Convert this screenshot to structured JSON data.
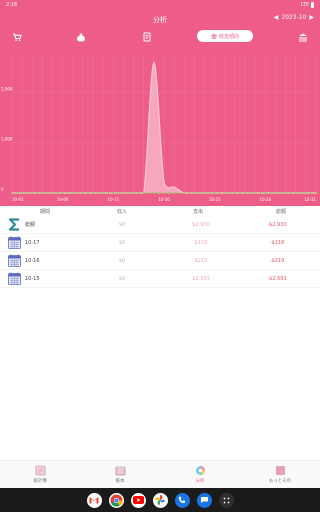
{
  "status_bar": {
    "time": "2:16",
    "network": "LTE"
  },
  "header": {
    "title": "分析",
    "month": "2023-10",
    "prev_icon": "chevron-left-icon",
    "next_icon": "chevron-right-icon",
    "mode_label": "收支傾向"
  },
  "toolbar": {
    "icons": [
      "cart-icon",
      "money-bag-icon",
      "receipt-icon",
      "bank-icon"
    ]
  },
  "chart_data": {
    "type": "area",
    "x_tick_labels": [
      "10-01",
      "10-06",
      "10-11",
      "10-16",
      "10-21",
      "10-26",
      "10-31"
    ],
    "y_tick_labels": [
      "2,000",
      "1,000",
      "0"
    ],
    "x": [
      "10-01",
      "10-02",
      "10-03",
      "10-04",
      "10-05",
      "10-06",
      "10-07",
      "10-08",
      "10-09",
      "10-10",
      "10-11",
      "10-12",
      "10-13",
      "10-14",
      "10-15",
      "10-16",
      "10-17",
      "10-18",
      "10-19",
      "10-20",
      "10-21",
      "10-22",
      "10-23",
      "10-24",
      "10-25",
      "10-26",
      "10-27",
      "10-28",
      "10-29",
      "10-30",
      "10-31"
    ],
    "series": [
      {
        "values": [
          0,
          0,
          0,
          0,
          0,
          0,
          0,
          0,
          0,
          0,
          0,
          0,
          0,
          0,
          2593,
          219,
          118,
          0,
          0,
          0,
          0,
          0,
          0,
          0,
          0,
          0,
          0,
          0,
          0,
          0,
          0
        ]
      }
    ],
    "ylim": [
      0,
      2800
    ],
    "colors": {
      "background": "#ee5d8a",
      "line": "#fbc8d6",
      "fill": "#fde2ea",
      "markers": "#9ccc65",
      "grid": "#f28aab"
    }
  },
  "table": {
    "headers": [
      "期間",
      "収入",
      "支出",
      "総額"
    ],
    "rows": [
      {
        "icon": "sigma-icon",
        "label": "総額",
        "income": "$0",
        "expense": "$2,930",
        "balance": "-$2,930"
      },
      {
        "icon": "calendar-icon",
        "label": "10-17",
        "income": "$0",
        "expense": "$118",
        "balance": "-$118"
      },
      {
        "icon": "calendar-icon",
        "label": "10-16",
        "income": "$0",
        "expense": "$219",
        "balance": "-$219"
      },
      {
        "icon": "calendar-icon",
        "label": "10-15",
        "income": "$0",
        "expense": "$2,593",
        "balance": "-$2,593"
      }
    ]
  },
  "bottom_nav": [
    {
      "label": "家計簿",
      "icon": "ledger-icon",
      "active": false
    },
    {
      "label": "帳本",
      "icon": "book-icon",
      "active": false
    },
    {
      "label": "分析",
      "icon": "pie-chart-icon",
      "active": true
    },
    {
      "label": "もっとその",
      "icon": "more-icon",
      "active": false
    }
  ],
  "dock": [
    "gmail-icon",
    "chrome-icon",
    "youtube-icon",
    "photos-icon",
    "phone-icon",
    "messages-icon",
    "app-drawer-icon"
  ]
}
